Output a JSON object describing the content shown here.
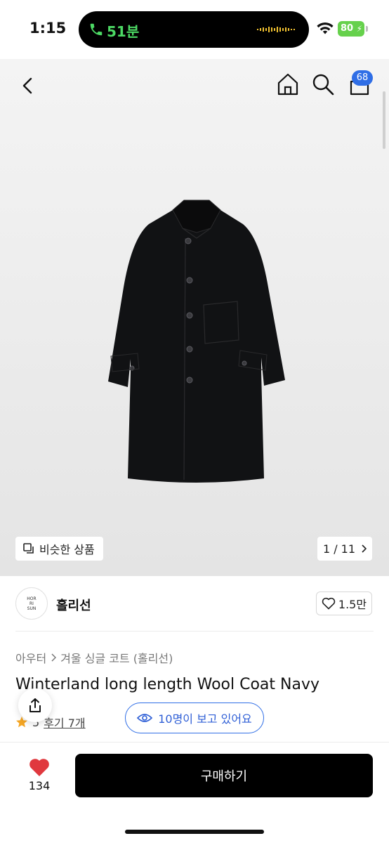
{
  "status_bar": {
    "time": "1:15",
    "call_duration": "51분",
    "battery": "80",
    "battery_color": "#66d14c",
    "call_color": "#4cd964"
  },
  "nav": {
    "back_icon": "chevron-left-icon",
    "home_icon": "home-icon",
    "search_icon": "search-icon",
    "cart_icon": "shopping-bag-icon",
    "cart_badge": "68",
    "badge_color": "#2f6ee6"
  },
  "gallery": {
    "similar_label": "비슷한 상품",
    "counter": "1 / 11"
  },
  "brand": {
    "logo_text": "HOR\nRI\nSUN",
    "name": "홀리선",
    "likes": "1.5만"
  },
  "product": {
    "breadcrumb": [
      "아우터",
      "겨울 싱글 코트 (홀리선)"
    ],
    "title": "Winterland long length Wool Coat Navy",
    "rating_partial": "5",
    "reviews": "후기 7개",
    "viewers": "10명이 보고 있어요"
  },
  "bottom_bar": {
    "wish_count": "134",
    "buy_label": "구매하기",
    "heart_color": "#e0383e"
  }
}
